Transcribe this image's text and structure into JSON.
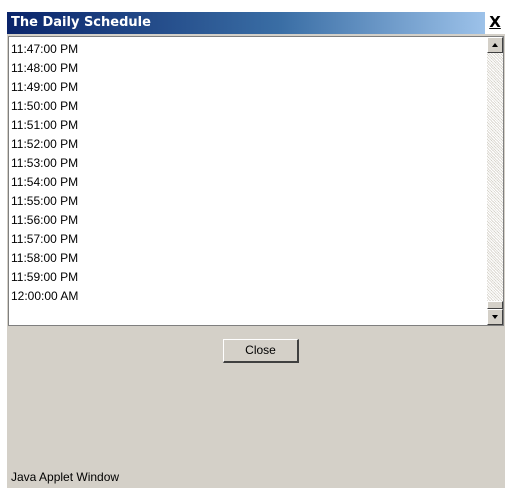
{
  "window": {
    "title": "The Daily Schedule",
    "close_glyph": "X",
    "applet_label": "Java Applet Window"
  },
  "schedule": {
    "items": [
      "11:47:00 PM",
      "11:48:00 PM",
      "11:49:00 PM",
      "11:50:00 PM",
      "11:51:00 PM",
      "11:52:00 PM",
      "11:53:00 PM",
      "11:54:00 PM",
      "11:55:00 PM",
      "11:56:00 PM",
      "11:57:00 PM",
      "11:58:00 PM",
      "11:59:00 PM",
      "12:00:00 AM"
    ],
    "scroll_position": 1.0
  },
  "buttons": {
    "close_label": "Close"
  },
  "colors": {
    "titlebar_start": "#0a246a",
    "titlebar_end": "#a6caf0",
    "window_bg": "#d4d0c8",
    "list_bg": "#ffffff"
  },
  "icons": {
    "close": "close-icon",
    "scroll_up": "arrow-up-icon",
    "scroll_down": "arrow-down-icon"
  }
}
